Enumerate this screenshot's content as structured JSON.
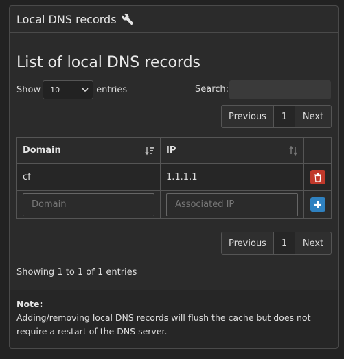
{
  "panel": {
    "title": "Local DNS records"
  },
  "heading": "List of local DNS records",
  "length": {
    "show_label": "Show",
    "selected": "10",
    "entries_label": "entries"
  },
  "search": {
    "label": "Search:",
    "value": "",
    "placeholder": ""
  },
  "pagination": {
    "previous": "Previous",
    "page": "1",
    "next": "Next"
  },
  "table": {
    "columns": [
      "Domain",
      "IP"
    ],
    "rows": [
      {
        "domain": "cf",
        "ip": "1.1.1.1"
      }
    ],
    "add_row": {
      "domain_placeholder": "Domain",
      "ip_placeholder": "Associated IP"
    }
  },
  "info": "Showing 1 to 1 of 1 entries",
  "note": {
    "title": "Note:",
    "text": "Adding/removing local DNS records will flush the cache but does not require a restart of the DNS server."
  },
  "colors": {
    "delete": "#c0392b",
    "add": "#2f81c0",
    "background": "#222222"
  }
}
